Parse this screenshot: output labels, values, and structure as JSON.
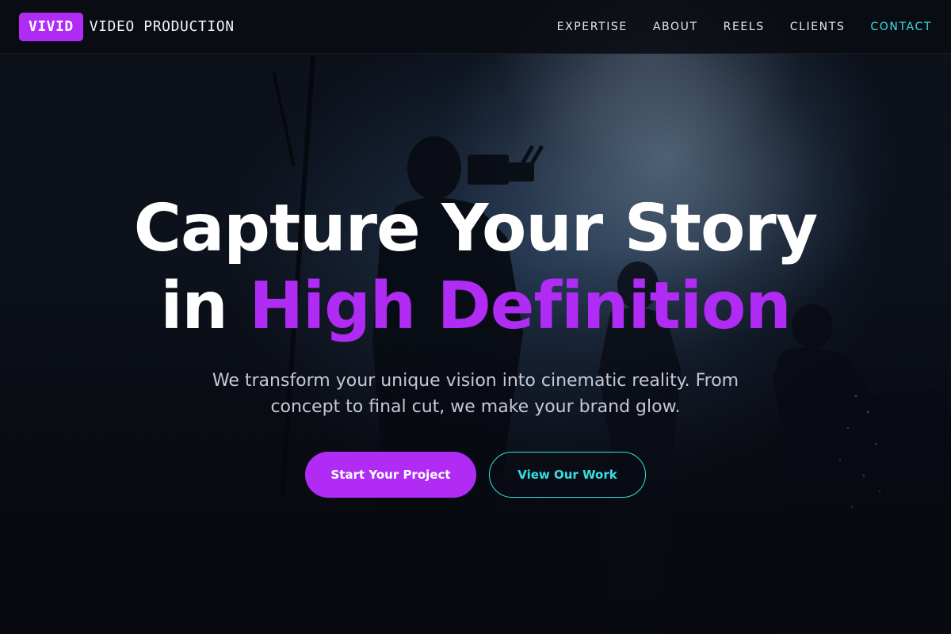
{
  "brand": {
    "badge": "VIVID",
    "name": "VIDEO PRODUCTION"
  },
  "nav": {
    "items": [
      {
        "label": "EXPERTISE"
      },
      {
        "label": "ABOUT"
      },
      {
        "label": "REELS"
      },
      {
        "label": "CLIENTS"
      },
      {
        "label": "CONTACT",
        "active": true
      }
    ]
  },
  "hero": {
    "headline_line1": "Capture Your Story",
    "headline_line2_prefix": "in",
    "headline_line2_accent": "High Definition",
    "subtext": "We transform your unique vision into cinematic reality. From concept to final cut, we make your brand glow.",
    "primary_cta": "Start Your Project",
    "secondary_cta": "View Our Work"
  },
  "colors": {
    "accent_purple": "#b02cf5",
    "accent_cyan": "#34e0e4",
    "background": "#0a0a12"
  }
}
